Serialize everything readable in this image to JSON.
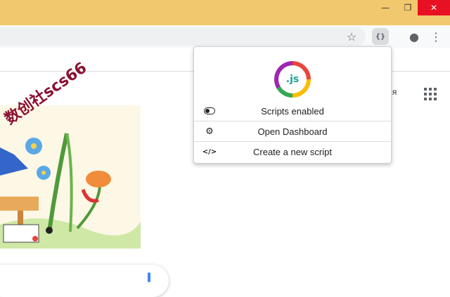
{
  "window": {
    "minimize_glyph": "—",
    "restore_glyph": "❐",
    "close_glyph": "✕"
  },
  "toolbar": {
    "star_glyph": "☆",
    "extension_glyph": "{}",
    "menu_glyph": "⋮",
    "profile_glyph": "●"
  },
  "page": {
    "side_text": "ення",
    "watermark": "数创社scs66"
  },
  "popup": {
    "logo_text": ".js",
    "items": [
      {
        "label": "Scripts enabled",
        "icon": "toggle-icon"
      },
      {
        "label": "Open Dashboard",
        "icon": "gear-icon",
        "glyph": "⚙"
      },
      {
        "label": "Create a new script",
        "icon": "code-icon",
        "glyph": "</>"
      }
    ]
  },
  "colors": {
    "titlebar": "#f1c86d",
    "close_button": "#e81123",
    "watermark": "#8b1030",
    "accent": "#4285f4"
  }
}
